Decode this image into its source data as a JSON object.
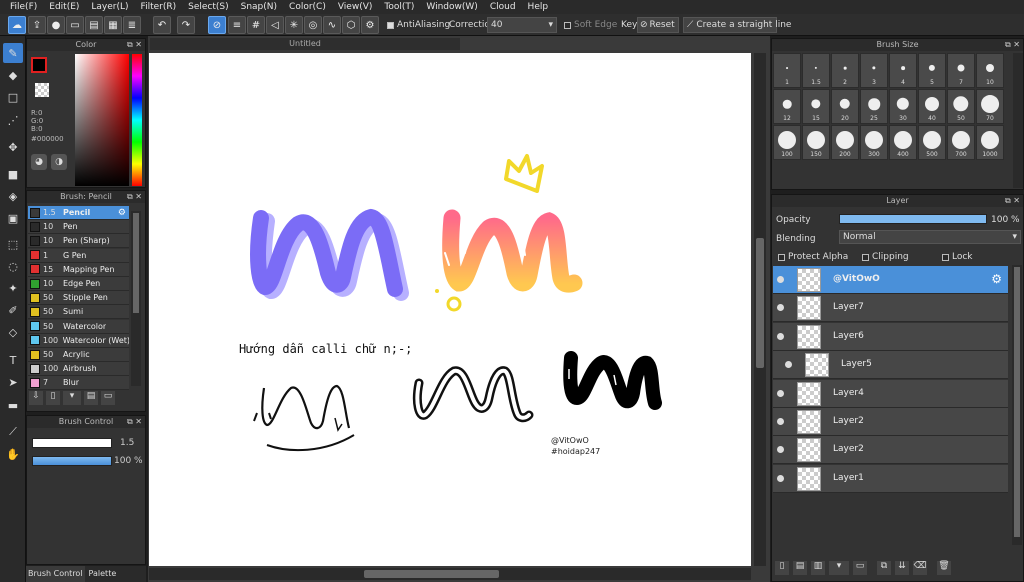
{
  "menu": [
    "File(F)",
    "Edit(E)",
    "Layer(L)",
    "Filter(R)",
    "Select(S)",
    "Snap(N)",
    "Color(C)",
    "View(V)",
    "Tool(T)",
    "Window(W)",
    "Cloud",
    "Help"
  ],
  "toolbar": {
    "antialias_label": "AntiAliasing",
    "correction_label": "Correction",
    "correction_value": "40",
    "soft_edge_label": "Soft Edge",
    "key_label": "Key",
    "reset_label": "Reset",
    "straight_line_label": "Create a straight line"
  },
  "canvas": {
    "tab_title": "Untitled",
    "heading": "Hướng dẫn calli chữ n;-;",
    "credit_line1": "@VitOwO",
    "credit_line2": "#hoidap247"
  },
  "color_panel": {
    "title": "Color",
    "r": "R:0",
    "g": "G:0",
    "b": "B:0",
    "hex": "#000000"
  },
  "brush_panel": {
    "title": "Brush: Pencil",
    "items": [
      {
        "size": "1.5",
        "name": "Pencil",
        "color": "#3a3a3a"
      },
      {
        "size": "10",
        "name": "Pen",
        "color": "#2a2a2a"
      },
      {
        "size": "10",
        "name": "Pen (Sharp)",
        "color": "#2a2a2a"
      },
      {
        "size": "1",
        "name": "G Pen",
        "color": "#e03030"
      },
      {
        "size": "15",
        "name": "Mapping Pen",
        "color": "#e03030"
      },
      {
        "size": "10",
        "name": "Edge Pen",
        "color": "#30a030"
      },
      {
        "size": "50",
        "name": "Stipple Pen",
        "color": "#e0c020"
      },
      {
        "size": "50",
        "name": "Sumi",
        "color": "#e0c020"
      },
      {
        "size": "50",
        "name": "Watercolor",
        "color": "#5fc8f0"
      },
      {
        "size": "100",
        "name": "Watercolor (Wet)",
        "color": "#5fc8f0"
      },
      {
        "size": "50",
        "name": "Acrylic",
        "color": "#e0c020"
      },
      {
        "size": "100",
        "name": "Airbrush",
        "color": "#cccccc"
      },
      {
        "size": "7",
        "name": "Blur",
        "color": "#f0a0d0"
      }
    ]
  },
  "brush_control": {
    "title": "Brush Control",
    "size_value": "1.5",
    "opacity_value": "100 %",
    "opacity": 1.0
  },
  "bottom_tabs": {
    "brush_control": "Brush Control",
    "palette": "Palette"
  },
  "brush_size": {
    "title": "Brush Size",
    "sizes": [
      "1",
      "1.5",
      "2",
      "3",
      "4",
      "5",
      "7",
      "10",
      "12",
      "15",
      "20",
      "25",
      "30",
      "40",
      "50",
      "70",
      "100",
      "150",
      "200",
      "300",
      "400",
      "500",
      "700",
      "1000"
    ]
  },
  "layer_panel": {
    "title": "Layer",
    "opacity_label": "Opacity",
    "opacity_value": "100 %",
    "blending_label": "Blending",
    "blending_value": "Normal",
    "protect_alpha": "Protect Alpha",
    "clipping": "Clipping",
    "lock": "Lock",
    "layers": [
      "@VitOwO",
      "Layer7",
      "Layer6",
      "Layer5",
      "Layer4",
      "Layer2",
      "Layer2",
      "Layer1"
    ]
  },
  "colors": {
    "accent": "#4a90d9",
    "panel": "#333333"
  }
}
